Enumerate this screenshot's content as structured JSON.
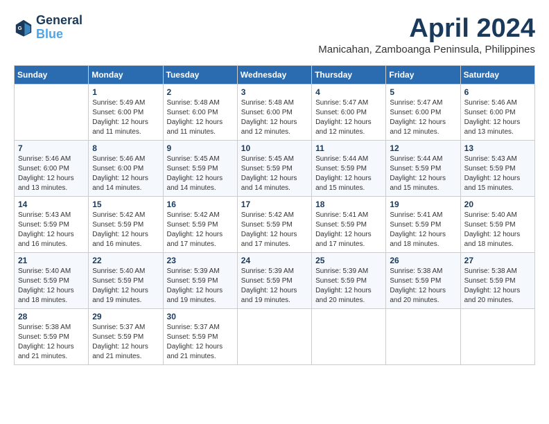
{
  "header": {
    "logo_line1": "General",
    "logo_line2": "Blue",
    "month_title": "April 2024",
    "subtitle": "Manicahan, Zamboanga Peninsula, Philippines"
  },
  "days_of_week": [
    "Sunday",
    "Monday",
    "Tuesday",
    "Wednesday",
    "Thursday",
    "Friday",
    "Saturday"
  ],
  "weeks": [
    [
      {
        "day": "",
        "sunrise": "",
        "sunset": "",
        "daylight": ""
      },
      {
        "day": "1",
        "sunrise": "Sunrise: 5:49 AM",
        "sunset": "Sunset: 6:00 PM",
        "daylight": "Daylight: 12 hours and 11 minutes."
      },
      {
        "day": "2",
        "sunrise": "Sunrise: 5:48 AM",
        "sunset": "Sunset: 6:00 PM",
        "daylight": "Daylight: 12 hours and 11 minutes."
      },
      {
        "day": "3",
        "sunrise": "Sunrise: 5:48 AM",
        "sunset": "Sunset: 6:00 PM",
        "daylight": "Daylight: 12 hours and 12 minutes."
      },
      {
        "day": "4",
        "sunrise": "Sunrise: 5:47 AM",
        "sunset": "Sunset: 6:00 PM",
        "daylight": "Daylight: 12 hours and 12 minutes."
      },
      {
        "day": "5",
        "sunrise": "Sunrise: 5:47 AM",
        "sunset": "Sunset: 6:00 PM",
        "daylight": "Daylight: 12 hours and 12 minutes."
      },
      {
        "day": "6",
        "sunrise": "Sunrise: 5:46 AM",
        "sunset": "Sunset: 6:00 PM",
        "daylight": "Daylight: 12 hours and 13 minutes."
      }
    ],
    [
      {
        "day": "7",
        "sunrise": "Sunrise: 5:46 AM",
        "sunset": "Sunset: 6:00 PM",
        "daylight": "Daylight: 12 hours and 13 minutes."
      },
      {
        "day": "8",
        "sunrise": "Sunrise: 5:46 AM",
        "sunset": "Sunset: 6:00 PM",
        "daylight": "Daylight: 12 hours and 14 minutes."
      },
      {
        "day": "9",
        "sunrise": "Sunrise: 5:45 AM",
        "sunset": "Sunset: 5:59 PM",
        "daylight": "Daylight: 12 hours and 14 minutes."
      },
      {
        "day": "10",
        "sunrise": "Sunrise: 5:45 AM",
        "sunset": "Sunset: 5:59 PM",
        "daylight": "Daylight: 12 hours and 14 minutes."
      },
      {
        "day": "11",
        "sunrise": "Sunrise: 5:44 AM",
        "sunset": "Sunset: 5:59 PM",
        "daylight": "Daylight: 12 hours and 15 minutes."
      },
      {
        "day": "12",
        "sunrise": "Sunrise: 5:44 AM",
        "sunset": "Sunset: 5:59 PM",
        "daylight": "Daylight: 12 hours and 15 minutes."
      },
      {
        "day": "13",
        "sunrise": "Sunrise: 5:43 AM",
        "sunset": "Sunset: 5:59 PM",
        "daylight": "Daylight: 12 hours and 15 minutes."
      }
    ],
    [
      {
        "day": "14",
        "sunrise": "Sunrise: 5:43 AM",
        "sunset": "Sunset: 5:59 PM",
        "daylight": "Daylight: 12 hours and 16 minutes."
      },
      {
        "day": "15",
        "sunrise": "Sunrise: 5:42 AM",
        "sunset": "Sunset: 5:59 PM",
        "daylight": "Daylight: 12 hours and 16 minutes."
      },
      {
        "day": "16",
        "sunrise": "Sunrise: 5:42 AM",
        "sunset": "Sunset: 5:59 PM",
        "daylight": "Daylight: 12 hours and 17 minutes."
      },
      {
        "day": "17",
        "sunrise": "Sunrise: 5:42 AM",
        "sunset": "Sunset: 5:59 PM",
        "daylight": "Daylight: 12 hours and 17 minutes."
      },
      {
        "day": "18",
        "sunrise": "Sunrise: 5:41 AM",
        "sunset": "Sunset: 5:59 PM",
        "daylight": "Daylight: 12 hours and 17 minutes."
      },
      {
        "day": "19",
        "sunrise": "Sunrise: 5:41 AM",
        "sunset": "Sunset: 5:59 PM",
        "daylight": "Daylight: 12 hours and 18 minutes."
      },
      {
        "day": "20",
        "sunrise": "Sunrise: 5:40 AM",
        "sunset": "Sunset: 5:59 PM",
        "daylight": "Daylight: 12 hours and 18 minutes."
      }
    ],
    [
      {
        "day": "21",
        "sunrise": "Sunrise: 5:40 AM",
        "sunset": "Sunset: 5:59 PM",
        "daylight": "Daylight: 12 hours and 18 minutes."
      },
      {
        "day": "22",
        "sunrise": "Sunrise: 5:40 AM",
        "sunset": "Sunset: 5:59 PM",
        "daylight": "Daylight: 12 hours and 19 minutes."
      },
      {
        "day": "23",
        "sunrise": "Sunrise: 5:39 AM",
        "sunset": "Sunset: 5:59 PM",
        "daylight": "Daylight: 12 hours and 19 minutes."
      },
      {
        "day": "24",
        "sunrise": "Sunrise: 5:39 AM",
        "sunset": "Sunset: 5:59 PM",
        "daylight": "Daylight: 12 hours and 19 minutes."
      },
      {
        "day": "25",
        "sunrise": "Sunrise: 5:39 AM",
        "sunset": "Sunset: 5:59 PM",
        "daylight": "Daylight: 12 hours and 20 minutes."
      },
      {
        "day": "26",
        "sunrise": "Sunrise: 5:38 AM",
        "sunset": "Sunset: 5:59 PM",
        "daylight": "Daylight: 12 hours and 20 minutes."
      },
      {
        "day": "27",
        "sunrise": "Sunrise: 5:38 AM",
        "sunset": "Sunset: 5:59 PM",
        "daylight": "Daylight: 12 hours and 20 minutes."
      }
    ],
    [
      {
        "day": "28",
        "sunrise": "Sunrise: 5:38 AM",
        "sunset": "Sunset: 5:59 PM",
        "daylight": "Daylight: 12 hours and 21 minutes."
      },
      {
        "day": "29",
        "sunrise": "Sunrise: 5:37 AM",
        "sunset": "Sunset: 5:59 PM",
        "daylight": "Daylight: 12 hours and 21 minutes."
      },
      {
        "day": "30",
        "sunrise": "Sunrise: 5:37 AM",
        "sunset": "Sunset: 5:59 PM",
        "daylight": "Daylight: 12 hours and 21 minutes."
      },
      {
        "day": "",
        "sunrise": "",
        "sunset": "",
        "daylight": ""
      },
      {
        "day": "",
        "sunrise": "",
        "sunset": "",
        "daylight": ""
      },
      {
        "day": "",
        "sunrise": "",
        "sunset": "",
        "daylight": ""
      },
      {
        "day": "",
        "sunrise": "",
        "sunset": "",
        "daylight": ""
      }
    ]
  ]
}
